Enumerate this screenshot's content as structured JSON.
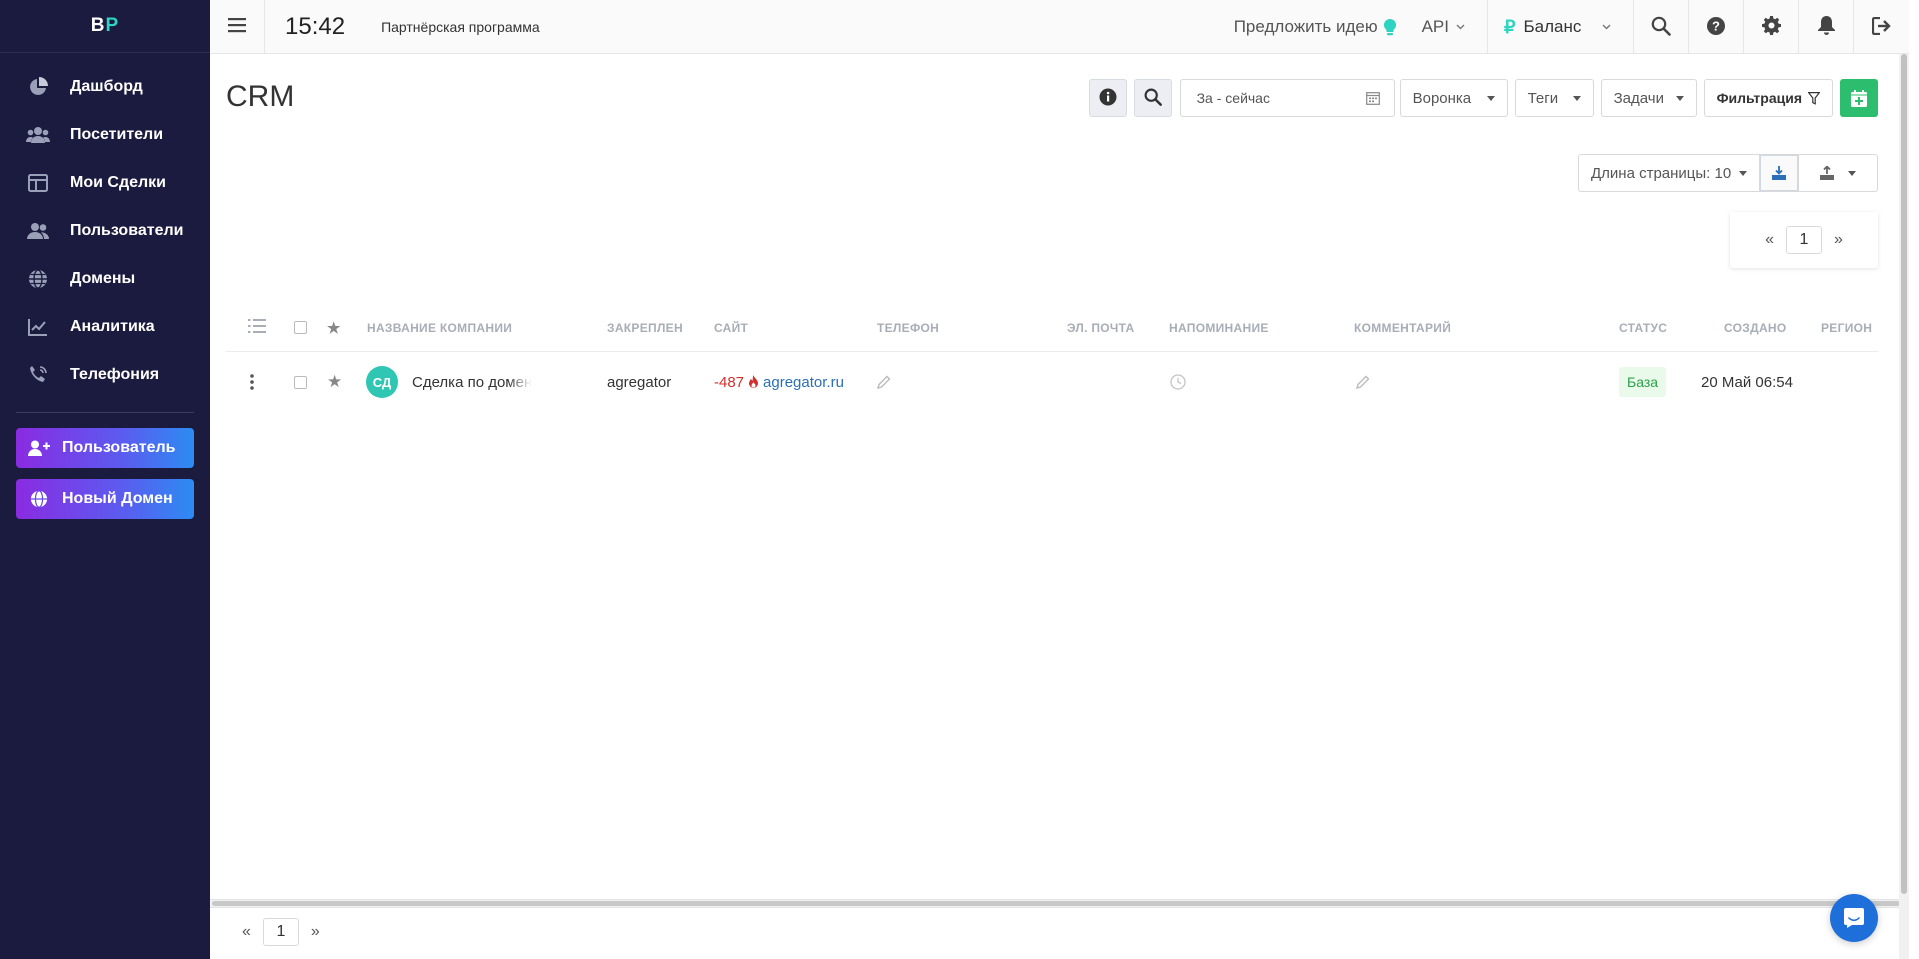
{
  "brand": {
    "logo_left": "B",
    "logo_right": "P"
  },
  "sidebar": {
    "items": [
      {
        "label": "Дашборд",
        "icon": "pie-chart-icon"
      },
      {
        "label": "Посетители",
        "icon": "visitors-icon"
      },
      {
        "label": "Мои Сделки",
        "icon": "deals-icon"
      },
      {
        "label": "Пользователи",
        "icon": "users-icon"
      },
      {
        "label": "Домены",
        "icon": "globe-icon"
      },
      {
        "label": "Аналитика",
        "icon": "analytics-icon"
      },
      {
        "label": "Телефония",
        "icon": "phone-icon"
      }
    ],
    "buttons": {
      "add_user": "Пользователь",
      "new_domain": "Новый Домен"
    }
  },
  "topbar": {
    "time": "15:42",
    "partner": "Партнёрская программа",
    "idea": "Предложить идею",
    "api": "API",
    "balance": "Баланс"
  },
  "page": {
    "title": "CRM",
    "date_placeholder": "За - сейчас",
    "funnel": "Воронка",
    "tags": "Теги",
    "tasks": "Задачи",
    "filter": "Фильтрация",
    "page_length": "Длина страницы: 10"
  },
  "pagination": {
    "prev": "«",
    "current": "1",
    "next": "»"
  },
  "table": {
    "columns": {
      "company": "Название компании",
      "assigned": "Закреплен",
      "site": "Сайт",
      "phone": "Телефон",
      "email": "Эл. почта",
      "reminder": "Напоминание",
      "comment": "Комментарий",
      "status": "Статус",
      "created": "Создано",
      "region": "Регион"
    },
    "rows": [
      {
        "avatar": "СД",
        "company": "Сделка по домену",
        "assigned": "agregator",
        "score": "-487",
        "site": "agregator.ru",
        "status": "База",
        "created": "20 Май 06:54"
      }
    ]
  },
  "colors": {
    "sidebar_bg": "#1b1b3f",
    "accent_teal": "#2fd3c1",
    "add_green": "#2dbd6e",
    "status_green": "#2aa24a",
    "link_blue": "#2a6fb7"
  }
}
